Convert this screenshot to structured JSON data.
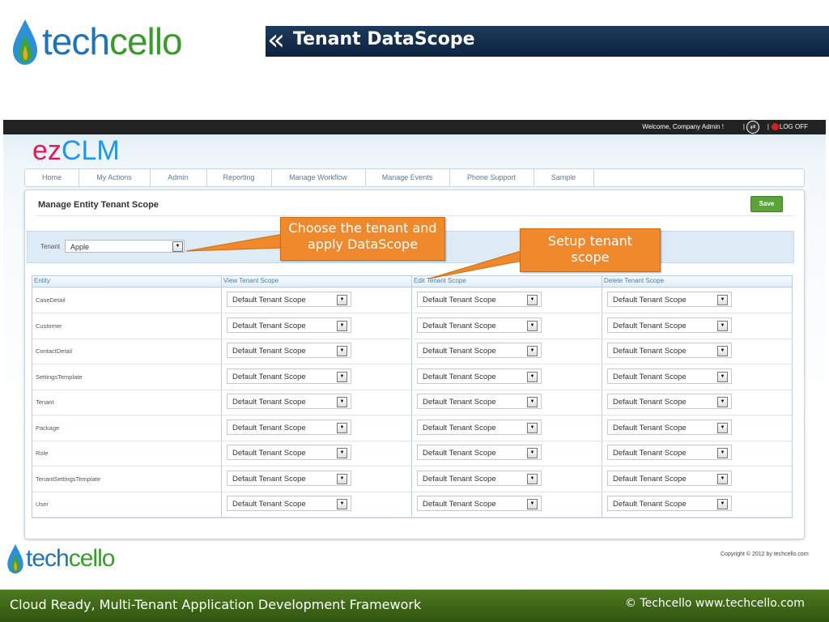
{
  "slide": {
    "logo": {
      "part1": "tech",
      "part2": "cello"
    },
    "title": "Tenant DataScope",
    "footer_left": "Cloud Ready, Multi-Tenant Application Development Framework",
    "footer_right": "© Techcello www.techcello.com"
  },
  "app": {
    "welcome": "Welcome, Company Admin !",
    "pipe": "|",
    "logoff": "LOG OFF",
    "brand": {
      "part1": "ez",
      "part2": "CLM"
    },
    "nav": [
      "Home",
      "My Actions",
      "Admin",
      "Reporting",
      "Manage Workflow",
      "Manage Events",
      "Phone Support",
      "Sample"
    ],
    "page_title": "Manage Entity Tenant Scope",
    "save_label": "Save",
    "tenant_label": "Tenant",
    "tenant_value": "Apple",
    "columns": [
      "Entity",
      "View Tenant Scope",
      "Edit Tenant Scope",
      "Delete Tenant Scope"
    ],
    "rows": [
      {
        "entity": "CaseDetail",
        "view": "Default Tenant Scope",
        "edit": "Default Tenant Scope",
        "delete": "Default Tenant Scope"
      },
      {
        "entity": "Customer",
        "view": "Default Tenant Scope",
        "edit": "Default Tenant Scope",
        "delete": "Default Tenant Scope"
      },
      {
        "entity": "ContactDetail",
        "view": "Default Tenant Scope",
        "edit": "Default Tenant Scope",
        "delete": "Default Tenant Scope"
      },
      {
        "entity": "SettingsTemplate",
        "view": "Default Tenant Scope",
        "edit": "Default Tenant Scope",
        "delete": "Default Tenant Scope"
      },
      {
        "entity": "Tenant",
        "view": "Default Tenant Scope",
        "edit": "Default Tenant Scope",
        "delete": "Default Tenant Scope"
      },
      {
        "entity": "Package",
        "view": "Default Tenant Scope",
        "edit": "Default Tenant Scope",
        "delete": "Default Tenant Scope"
      },
      {
        "entity": "Role",
        "view": "Default Tenant Scope",
        "edit": "Default Tenant Scope",
        "delete": "Default Tenant Scope"
      },
      {
        "entity": "TenantSettingsTemplate",
        "view": "Default Tenant Scope",
        "edit": "Default Tenant Scope",
        "delete": "Default Tenant Scope"
      },
      {
        "entity": "User",
        "view": "Default Tenant Scope",
        "edit": "Default Tenant Scope",
        "delete": "Default Tenant Scope"
      }
    ],
    "copyright": "Copyright © 2012 by techcello.com"
  },
  "callouts": {
    "tenant": "Choose the tenant and apply  DataScope",
    "scope": "Setup tenant scope"
  },
  "colors": {
    "accent": "#f0892b",
    "save": "#5aa43a",
    "header": "#0d2340",
    "footer": "#3b6616"
  },
  "icons": {
    "dropdown": "dropdown-arrow-icon",
    "swap": "swap-icon",
    "power": "power-icon",
    "logo": "drop-icon"
  }
}
